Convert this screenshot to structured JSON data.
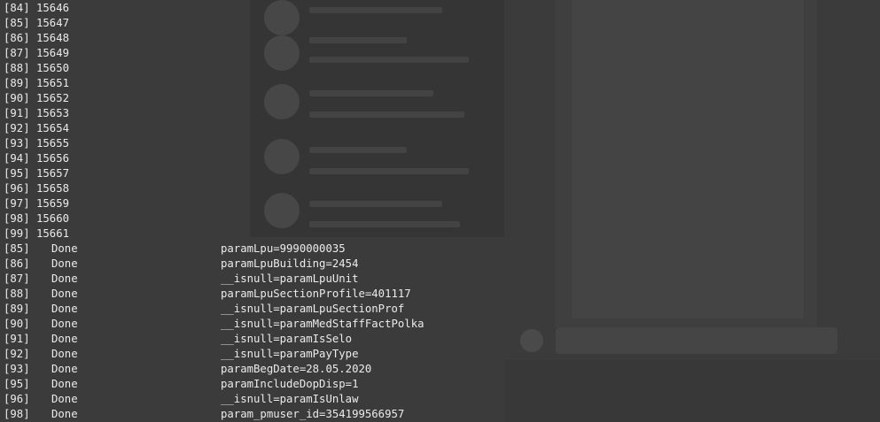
{
  "ids_section": [
    {
      "idx": "[84]",
      "id": "15646"
    },
    {
      "idx": "[85]",
      "id": "15647"
    },
    {
      "idx": "[86]",
      "id": "15648"
    },
    {
      "idx": "[87]",
      "id": "15649"
    },
    {
      "idx": "[88]",
      "id": "15650"
    },
    {
      "idx": "[89]",
      "id": "15651"
    },
    {
      "idx": "[90]",
      "id": "15652"
    },
    {
      "idx": "[91]",
      "id": "15653"
    },
    {
      "idx": "[92]",
      "id": "15654"
    },
    {
      "idx": "[93]",
      "id": "15655"
    },
    {
      "idx": "[94]",
      "id": "15656"
    },
    {
      "idx": "[95]",
      "id": "15657"
    },
    {
      "idx": "[96]",
      "id": "15658"
    },
    {
      "idx": "[97]",
      "id": "15659"
    },
    {
      "idx": "[98]",
      "id": "15660"
    },
    {
      "idx": "[99]",
      "id": "15661"
    }
  ],
  "done_section": [
    {
      "idx": "[85]",
      "status": "Done",
      "param": "paramLpu=9990000035"
    },
    {
      "idx": "[86]",
      "status": "Done",
      "param": "paramLpuBuilding=2454"
    },
    {
      "idx": "[87]",
      "status": "Done",
      "param": "__isnull=paramLpuUnit"
    },
    {
      "idx": "[88]",
      "status": "Done",
      "param": "paramLpuSectionProfile=401117"
    },
    {
      "idx": "[89]",
      "status": "Done",
      "param": "__isnull=paramLpuSectionProf"
    },
    {
      "idx": "[90]",
      "status": "Done",
      "param": "__isnull=paramMedStaffFactPolka"
    },
    {
      "idx": "[91]",
      "status": "Done",
      "param": "__isnull=paramIsSelo"
    },
    {
      "idx": "[92]",
      "status": "Done",
      "param": "__isnull=paramPayType"
    },
    {
      "idx": "[93]",
      "status": "Done",
      "param": "paramBegDate=28.05.2020"
    },
    {
      "idx": "[95]",
      "status": "Done",
      "param": "paramIncludeDopDisp=1"
    },
    {
      "idx": "[96]",
      "status": "Done",
      "param": "__isnull=paramIsUnlaw"
    },
    {
      "idx": "[98]",
      "status": "Done",
      "param": "param_pmuser_id=354199566957"
    }
  ]
}
